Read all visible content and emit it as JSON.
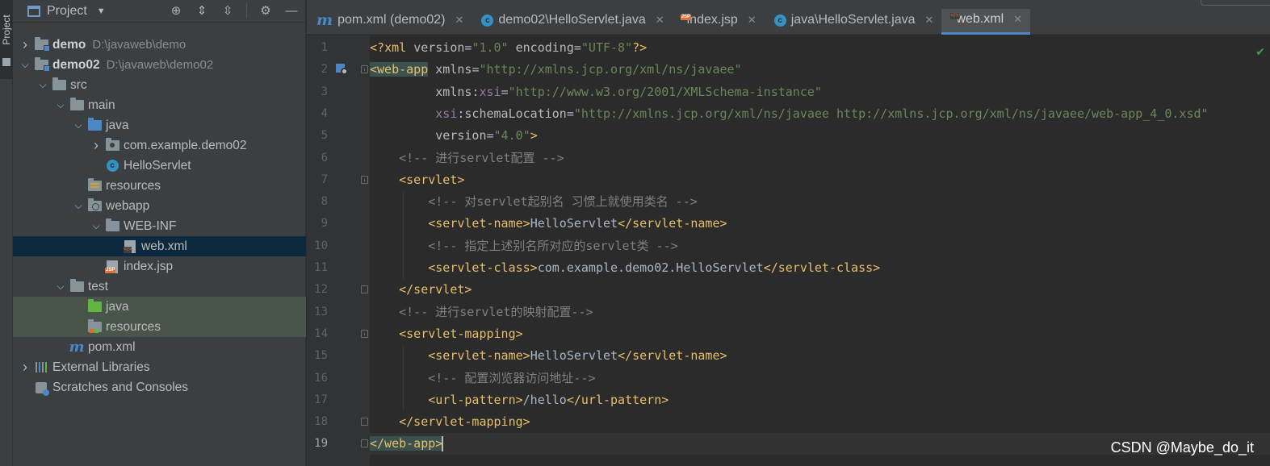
{
  "tool_stripe": {
    "project_tab": "Project"
  },
  "project_panel": {
    "title": "Project",
    "tree": [
      {
        "label": "demo",
        "path": "D:\\javaweb\\demo",
        "icon": "module-folder-icon",
        "depth": 0,
        "arrow": "collapsed",
        "bold": true
      },
      {
        "label": "demo02",
        "path": "D:\\javaweb\\demo02",
        "icon": "module-folder-icon",
        "depth": 0,
        "arrow": "expanded",
        "bold": true
      },
      {
        "label": "src",
        "icon": "folder-icon",
        "depth": 1,
        "arrow": "expanded"
      },
      {
        "label": "main",
        "icon": "folder-icon",
        "depth": 2,
        "arrow": "expanded"
      },
      {
        "label": "java",
        "icon": "source-folder-icon",
        "depth": 3,
        "arrow": "expanded"
      },
      {
        "label": "com.example.demo02",
        "icon": "package-icon",
        "depth": 4,
        "arrow": "collapsed"
      },
      {
        "label": "HelloServlet",
        "icon": "class-icon",
        "depth": 4,
        "arrow": "none"
      },
      {
        "label": "resources",
        "icon": "resources-folder-icon",
        "depth": 3,
        "arrow": "none"
      },
      {
        "label": "webapp",
        "icon": "web-folder-icon",
        "depth": 3,
        "arrow": "expanded"
      },
      {
        "label": "WEB-INF",
        "icon": "folder-icon",
        "depth": 4,
        "arrow": "expanded"
      },
      {
        "label": "web.xml",
        "icon": "xml-file-icon",
        "depth": 5,
        "arrow": "none",
        "selected": true
      },
      {
        "label": "index.jsp",
        "icon": "jsp-file-icon",
        "depth": 4,
        "arrow": "none"
      },
      {
        "label": "test",
        "icon": "folder-icon",
        "depth": 2,
        "arrow": "expanded"
      },
      {
        "label": "java",
        "icon": "test-source-folder-icon",
        "depth": 3,
        "arrow": "none",
        "test": true
      },
      {
        "label": "resources",
        "icon": "test-resources-folder-icon",
        "depth": 3,
        "arrow": "none",
        "test": true
      },
      {
        "label": "pom.xml",
        "icon": "maven-icon",
        "depth": 2,
        "arrow": "none"
      },
      {
        "label": "External Libraries",
        "icon": "libraries-icon",
        "depth": 0,
        "arrow": "collapsed"
      },
      {
        "label": "Scratches and Consoles",
        "icon": "scratches-icon",
        "depth": 0,
        "arrow": "none"
      }
    ]
  },
  "editor_tabs": [
    {
      "label": "pom.xml (demo02)",
      "icon": "maven-icon",
      "active": false
    },
    {
      "label": "demo02\\HelloServlet.java",
      "icon": "class-icon",
      "active": false
    },
    {
      "label": "index.jsp",
      "icon": "jsp-file-icon",
      "active": false
    },
    {
      "label": "java\\HelloServlet.java",
      "icon": "class-icon",
      "active": false
    },
    {
      "label": "web.xml",
      "icon": "xml-file-icon",
      "active": true
    }
  ],
  "editor": {
    "current_line": 19,
    "lines": [
      {
        "n": "1",
        "parts": [
          [
            "tag",
            "<?"
          ],
          [
            "tag",
            "xml "
          ],
          [
            "attr",
            "version"
          ],
          [
            "txt",
            "="
          ],
          [
            "str",
            "\"1.0\""
          ],
          [
            "txt",
            " "
          ],
          [
            "attr",
            "encoding"
          ],
          [
            "txt",
            "="
          ],
          [
            "str",
            "\"UTF-8\""
          ],
          [
            "tag",
            "?>"
          ]
        ]
      },
      {
        "n": "2",
        "parts": [
          [
            "tagm",
            "<web-app"
          ],
          [
            "txt",
            " "
          ],
          [
            "attr",
            "xmlns"
          ],
          [
            "txt",
            "="
          ],
          [
            "str",
            "\"http://xmlns.jcp.org/xml/ns/javaee\""
          ]
        ]
      },
      {
        "n": "3",
        "parts": [
          [
            "txt",
            "         "
          ],
          [
            "attr",
            "xmlns"
          ],
          [
            "txt",
            ":"
          ],
          [
            "ns",
            "xsi"
          ],
          [
            "txt",
            "="
          ],
          [
            "str",
            "\"http://www.w3.org/2001/XMLSchema-instance\""
          ]
        ]
      },
      {
        "n": "4",
        "parts": [
          [
            "txt",
            "         "
          ],
          [
            "ns",
            "xsi"
          ],
          [
            "txt",
            ":"
          ],
          [
            "attr",
            "schemaLocation"
          ],
          [
            "txt",
            "="
          ],
          [
            "str",
            "\"http://xmlns.jcp.org/xml/ns/javaee http://xmlns.jcp.org/xml/ns/javaee/web-app_4_0.xsd\""
          ]
        ]
      },
      {
        "n": "5",
        "parts": [
          [
            "txt",
            "         "
          ],
          [
            "attr",
            "version"
          ],
          [
            "txt",
            "="
          ],
          [
            "str",
            "\"4.0\""
          ],
          [
            "tag",
            ">"
          ]
        ]
      },
      {
        "n": "6",
        "parts": [
          [
            "txt",
            "    "
          ],
          [
            "cmt",
            "<!-- 进行servlet配置 -->"
          ]
        ]
      },
      {
        "n": "7",
        "parts": [
          [
            "txt",
            "    "
          ],
          [
            "tag",
            "<servlet>"
          ]
        ]
      },
      {
        "n": "8",
        "parts": [
          [
            "txt",
            "        "
          ],
          [
            "cmt",
            "<!-- 对servlet起别名 习惯上就使用类名 -->"
          ]
        ]
      },
      {
        "n": "9",
        "parts": [
          [
            "txt",
            "        "
          ],
          [
            "tag",
            "<servlet-name>"
          ],
          [
            "txt",
            "HelloServlet"
          ],
          [
            "tag",
            "</servlet-name>"
          ]
        ]
      },
      {
        "n": "10",
        "parts": [
          [
            "txt",
            "        "
          ],
          [
            "cmt",
            "<!-- 指定上述别名所对应的servlet类 -->"
          ]
        ]
      },
      {
        "n": "11",
        "parts": [
          [
            "txt",
            "        "
          ],
          [
            "tag",
            "<servlet-class>"
          ],
          [
            "txt",
            "com.example.demo02.HelloServlet"
          ],
          [
            "tag",
            "</servlet-class>"
          ]
        ]
      },
      {
        "n": "12",
        "parts": [
          [
            "txt",
            "    "
          ],
          [
            "tag",
            "</servlet>"
          ]
        ]
      },
      {
        "n": "13",
        "parts": [
          [
            "txt",
            "    "
          ],
          [
            "cmt",
            "<!-- 进行servlet的映射配置-->"
          ]
        ]
      },
      {
        "n": "14",
        "parts": [
          [
            "txt",
            "    "
          ],
          [
            "tag",
            "<servlet-mapping>"
          ]
        ]
      },
      {
        "n": "15",
        "parts": [
          [
            "txt",
            "        "
          ],
          [
            "tag",
            "<servlet-name>"
          ],
          [
            "txt",
            "HelloServlet"
          ],
          [
            "tag",
            "</servlet-name>"
          ]
        ]
      },
      {
        "n": "16",
        "parts": [
          [
            "txt",
            "        "
          ],
          [
            "cmt",
            "<!-- 配置浏览器访问地址-->"
          ]
        ]
      },
      {
        "n": "17",
        "parts": [
          [
            "txt",
            "        "
          ],
          [
            "tag",
            "<url-pattern>"
          ],
          [
            "txt",
            "/hello"
          ],
          [
            "tag",
            "</url-pattern>"
          ]
        ]
      },
      {
        "n": "18",
        "parts": [
          [
            "txt",
            "    "
          ],
          [
            "tag",
            "</servlet-mapping>"
          ]
        ]
      },
      {
        "n": "19",
        "parts": [
          [
            "tagm",
            "</web-app>"
          ]
        ]
      }
    ]
  },
  "watermark": "CSDN @Maybe_do_it",
  "colors": {
    "accent": "#4a88c7",
    "selection": "#0d293e",
    "test_row": "#49544a",
    "tag": "#e8bf6a",
    "string": "#6a8759",
    "comment": "#808080"
  }
}
